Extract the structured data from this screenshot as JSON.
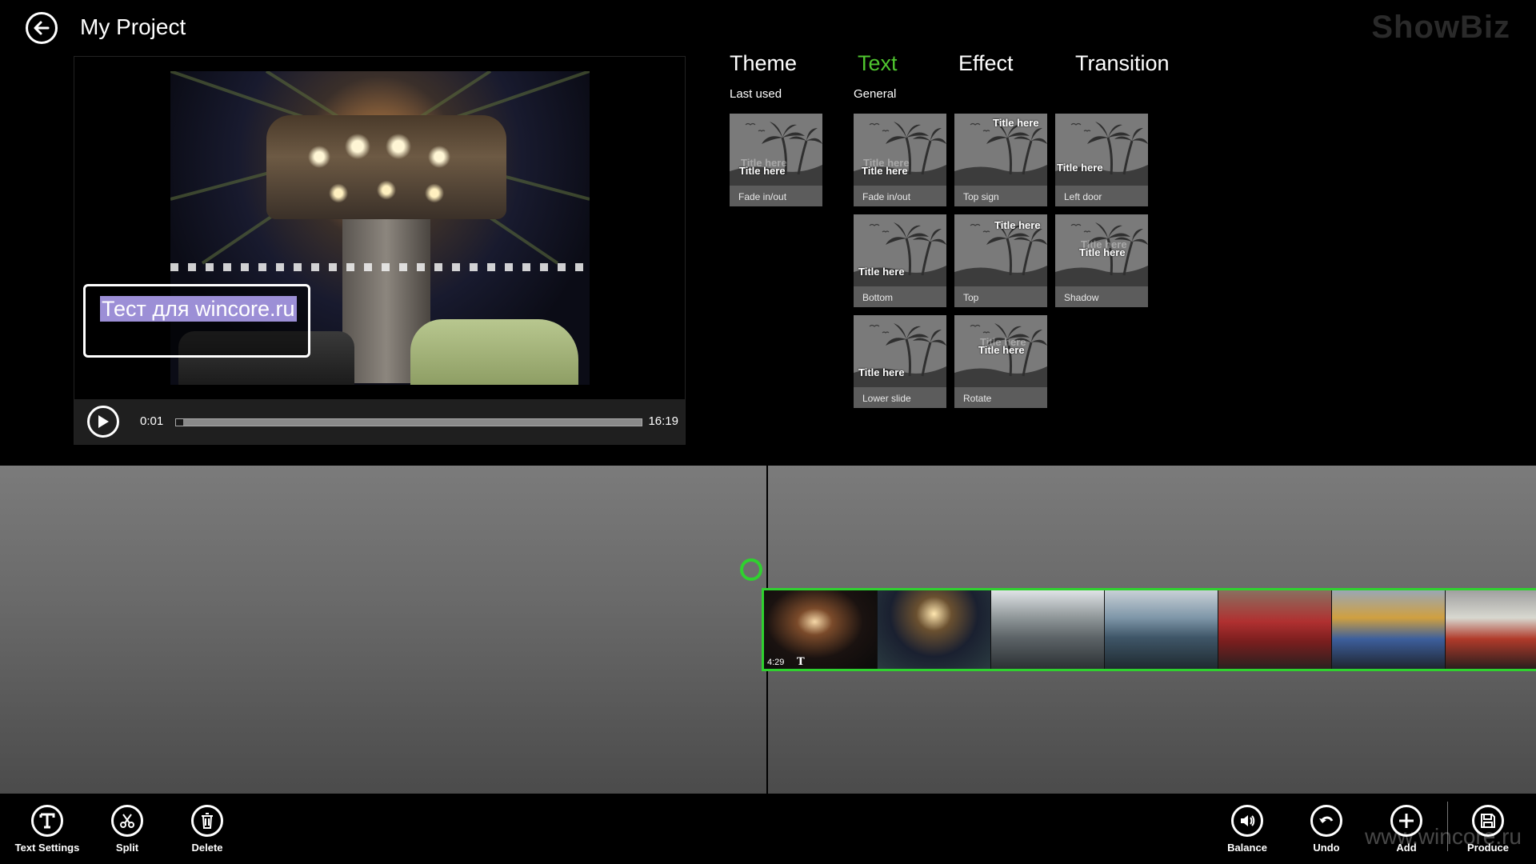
{
  "header": {
    "title": "My Project",
    "back_icon": "back-arrow-icon",
    "watermark": "ShowBiz"
  },
  "preview": {
    "overlay_text": "Тест для wincore.ru",
    "time_current": "0:01",
    "time_total": "16:19",
    "progress_fraction": 0.001
  },
  "tabs": [
    {
      "label": "Theme",
      "active": false
    },
    {
      "label": "Text",
      "active": true
    },
    {
      "label": "Effect",
      "active": false
    },
    {
      "label": "Transition",
      "active": false
    }
  ],
  "sections": {
    "last_used": "Last used",
    "general": "General"
  },
  "tile_title_text": "Title here",
  "last_used_tiles": [
    {
      "caption": "Fade in/out"
    }
  ],
  "general_tiles": [
    {
      "caption": "Fade in/out"
    },
    {
      "caption": "Top sign"
    },
    {
      "caption": "Left door"
    },
    {
      "caption": "Bottom"
    },
    {
      "caption": "Top"
    },
    {
      "caption": "Shadow"
    },
    {
      "caption": "Lower slide"
    },
    {
      "caption": "Rotate"
    }
  ],
  "timeline": {
    "clip_duration": "4:29",
    "clip_text_icon": "T"
  },
  "appbar": {
    "left": [
      {
        "label": "Text Settings",
        "icon": "text-t-icon"
      },
      {
        "label": "Split",
        "icon": "scissors-icon"
      },
      {
        "label": "Delete",
        "icon": "trash-icon"
      }
    ],
    "right": [
      {
        "label": "Balance",
        "icon": "speaker-icon"
      },
      {
        "label": "Undo",
        "icon": "undo-icon"
      },
      {
        "label": "Add",
        "icon": "plus-icon"
      },
      {
        "label": "Produce",
        "icon": "save-disk-icon"
      }
    ]
  },
  "colors": {
    "accent": "#4fc52f",
    "selection": "#9c8fd6"
  },
  "watermark_bottom": "www.wincore.ru"
}
